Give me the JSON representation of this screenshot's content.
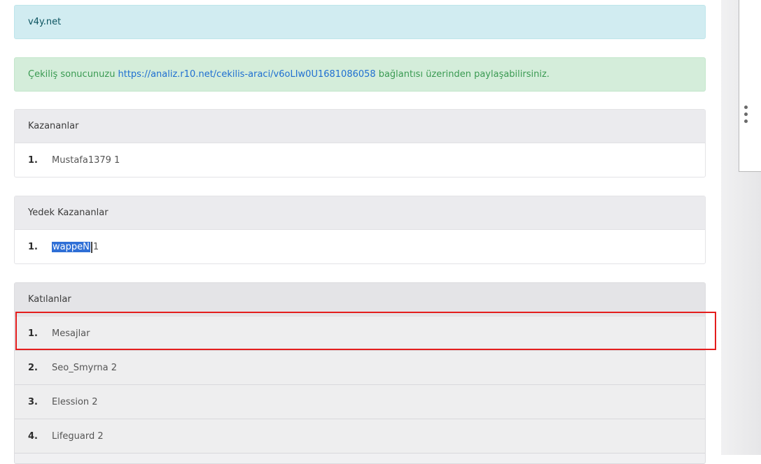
{
  "info_alert": {
    "text": "v4y.net"
  },
  "success_alert": {
    "prefix": "Çekiliş sonucunuzu",
    "link": "https://analiz.r10.net/cekilis-araci/v6oLIw0U1681086058",
    "suffix": "bağlantısı üzerinden paylaşabilirsiniz."
  },
  "winners": {
    "title": "Kazananlar",
    "rows": [
      {
        "num": "1.",
        "name": "Mustafa1379 1"
      }
    ]
  },
  "backup_winners": {
    "title": "Yedek Kazananlar",
    "rows": [
      {
        "num": "1.",
        "name_selected": "wappeN",
        "name_rest": "1"
      }
    ]
  },
  "participants": {
    "title": "Katılanlar",
    "rows": [
      {
        "num": "1.",
        "name": "Mesajlar"
      },
      {
        "num": "2.",
        "name": "Seo_Smyrna 2"
      },
      {
        "num": "3.",
        "name": "Elession 2"
      },
      {
        "num": "4.",
        "name": "Lifeguard 2"
      }
    ]
  },
  "colors": {
    "highlight": "#e41d1d",
    "link": "#1f6fd1",
    "success_text": "#3a9a52",
    "selection": "#2f6fd6"
  },
  "icons": {
    "more": "more-vertical-icon"
  }
}
